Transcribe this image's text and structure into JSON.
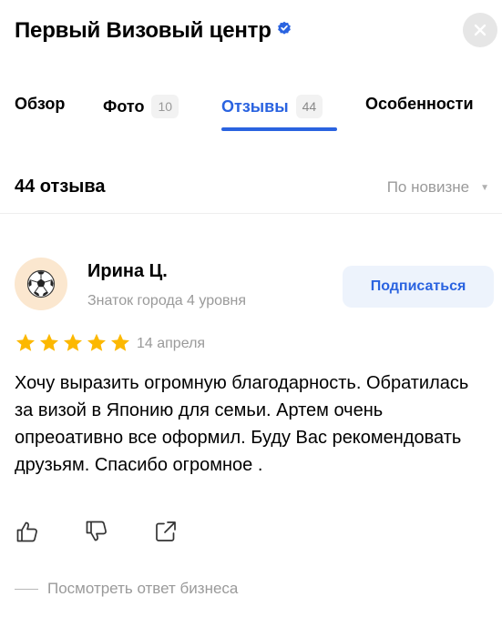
{
  "header": {
    "title": "Первый Визовый центр",
    "verified_icon": "verified-badge-icon",
    "close_icon": "close-icon"
  },
  "tabs": [
    {
      "label": "Обзор",
      "count": ""
    },
    {
      "label": "Фото",
      "count": "10"
    },
    {
      "label": "Отзывы",
      "count": "44",
      "active": true
    },
    {
      "label": "Особенности",
      "count": ""
    }
  ],
  "summary": {
    "review_count": "44 отзыва",
    "sort_label": "По новизне"
  },
  "review": {
    "author": "Ирина Ц.",
    "author_level": "Знаток города 4 уровня",
    "subscribe_label": "Подписаться",
    "rating": 5,
    "date": "14 апреля",
    "text": "Хочу выразить огромную благодарность. Обратилась за визой в Японию для семьи. Артем очень опреоативно все оформил. Буду Вас рекомендовать друзьям. Спасибо огромное .",
    "business_reply_label": "Посмотреть ответ бизнеса"
  },
  "colors": {
    "accent": "#2a63e0",
    "star": "#fcb800",
    "muted": "#9a9a9a"
  }
}
